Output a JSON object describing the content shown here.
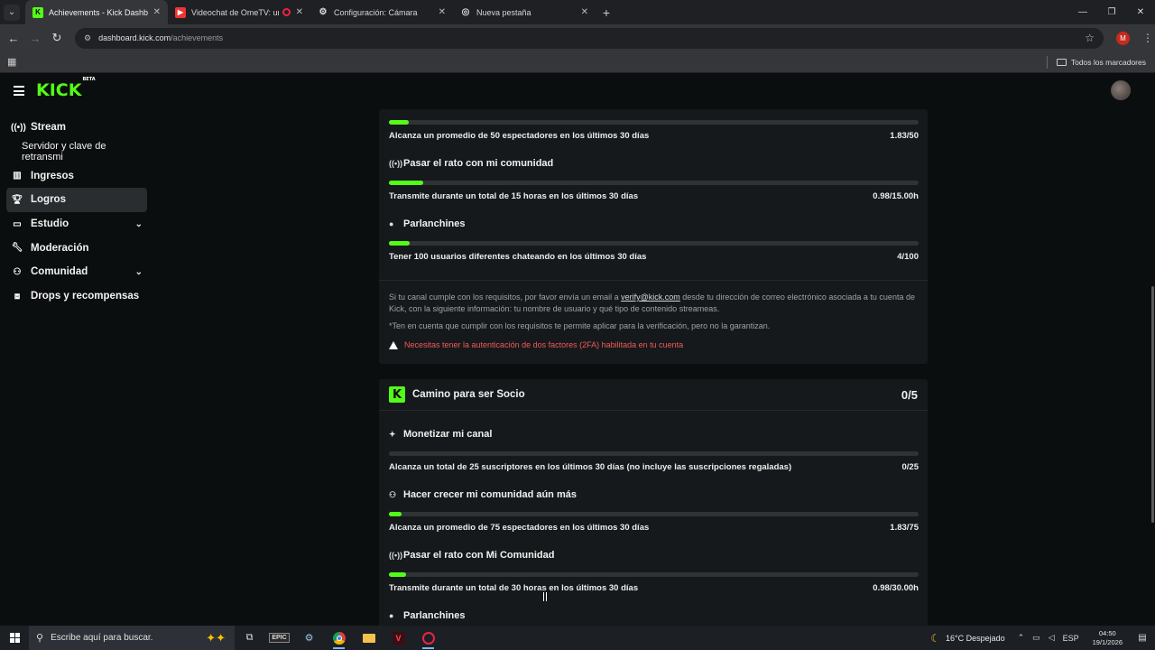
{
  "browser": {
    "tabs": [
      {
        "title": "Achievements - Kick Dashboard",
        "active": true
      },
      {
        "title": "Videochat de OmeTV: una a",
        "recording": true
      },
      {
        "title": "Configuración: Cámara"
      },
      {
        "title": "Nueva pestaña"
      }
    ],
    "url_host": "dashboard.kick.com",
    "url_path": "/achievements",
    "profile_initial": "M",
    "bookmarks_all": "Todos los marcadores"
  },
  "app": {
    "logo": "KICK",
    "logo_badge": "BETA"
  },
  "sidebar": {
    "items": [
      {
        "label": "Stream",
        "icon": "broadcast-icon"
      },
      {
        "label": "Servidor y clave de retransmi",
        "sub": true
      },
      {
        "label": "Ingresos",
        "icon": "chart-icon"
      },
      {
        "label": "Logros",
        "icon": "trophy-icon",
        "active": true
      },
      {
        "label": "Estudio",
        "icon": "studio-icon",
        "expandable": true
      },
      {
        "label": "Moderación",
        "icon": "wrench-icon"
      },
      {
        "label": "Comunidad",
        "icon": "community-icon",
        "expandable": true
      },
      {
        "label": "Drops y recompensas",
        "icon": "gift-icon"
      }
    ]
  },
  "card1": {
    "items": [
      {
        "requirement": "Alcanza un promedio de 50 espectadores en los últimos 30 días",
        "value": "1.83/50",
        "progress": 0.037
      },
      {
        "title": "Pasar el rato con mi comunidad",
        "requirement": "Transmite durante un total de 15 horas en los últimos 30 días",
        "value": "0.98/15.00h",
        "progress": 0.065
      },
      {
        "title": "Parlanchines",
        "requirement": "Tener 100 usuarios diferentes chateando en los últimos 30 días",
        "value": "4/100",
        "progress": 0.04
      }
    ],
    "notice_pre": "Si tu canal cumple con los requisitos, por favor envía un email a ",
    "notice_link": "verify@kick.com",
    "notice_post": " desde tu dirección de correo electrónico asociada a tu cuenta de Kick, con la siguiente información: tu nombre de usuario y qué tipo de contenido streameas.",
    "disclaimer": "*Ten en cuenta que cumplir con los requisitos te permite aplicar para la verificación, pero no la garantizan.",
    "warning": "Necesitas tener la autenticación de dos factores (2FA) habilitada en tu cuenta"
  },
  "card2": {
    "badge": "K",
    "title": "Camino para ser Socio",
    "count": "0/5",
    "items": [
      {
        "title": "Monetizar mi canal",
        "icon": "sparkle-icon",
        "requirement": "Alcanza un total de 25 suscriptores en los últimos 30 días (no incluye las suscripciones regaladas)",
        "value": "0/25",
        "progress": 0.0
      },
      {
        "title": "Hacer crecer mi comunidad aún más",
        "icon": "users-icon",
        "requirement": "Alcanza un promedio de 75 espectadores en los últimos 30 días",
        "value": "1.83/75",
        "progress": 0.024
      },
      {
        "title": "Pasar el rato con Mi Comunidad",
        "icon": "broadcast-icon",
        "requirement": "Transmite durante un total de 30 horas en los últimos 30 días",
        "value": "0.98/30.00h",
        "progress": 0.033
      },
      {
        "title": "Parlanchines",
        "icon": "chat-icon"
      }
    ]
  },
  "taskbar": {
    "search_placeholder": "Escribe aquí para buscar.",
    "weather": "16°C  Despejado",
    "language": "ESP",
    "time": "04:50",
    "date": "19/1/2026"
  }
}
